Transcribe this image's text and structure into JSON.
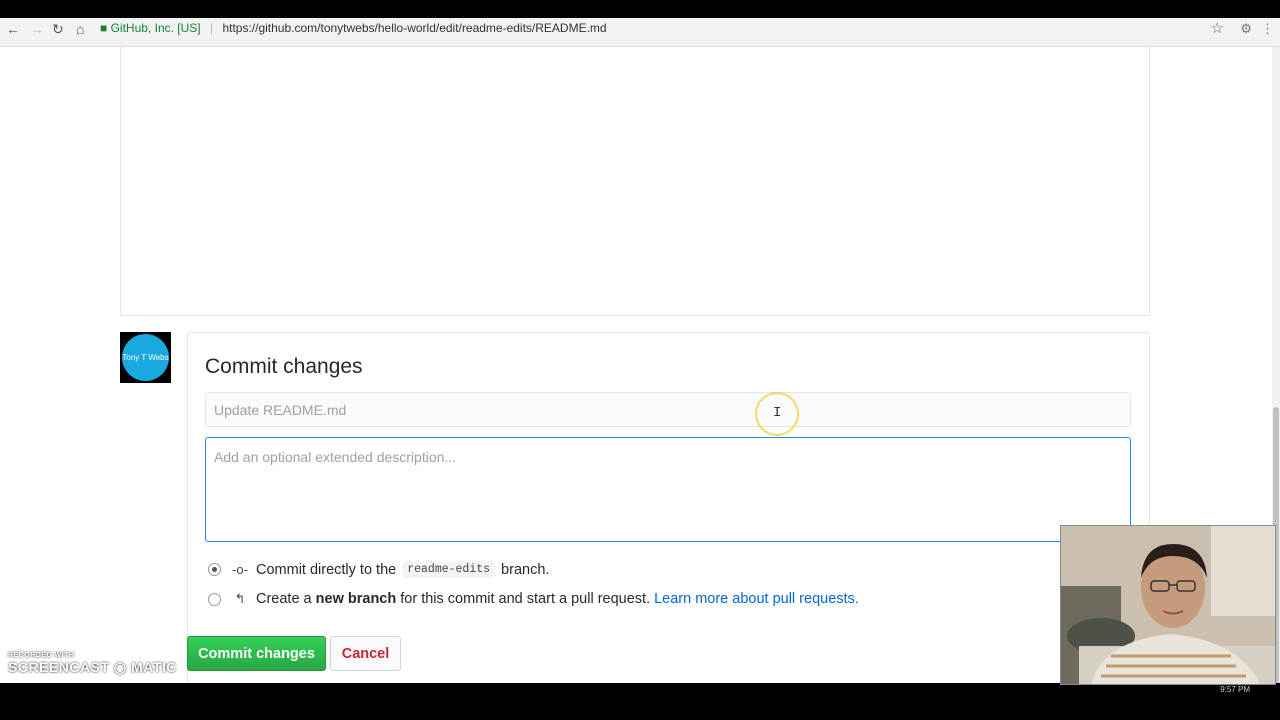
{
  "browser": {
    "security_label": "GitHub, Inc. [US]",
    "url": "https://github.com/tonytwebs/hello-world/edit/readme-edits/README.md"
  },
  "avatar": {
    "text": "Tony T Webs"
  },
  "commit": {
    "title": "Commit changes",
    "summary_placeholder": "Update README.md",
    "description_placeholder": "Add an optional extended description...",
    "option_direct": {
      "prefix": "Commit directly to the",
      "branch": "readme-edits",
      "suffix": "branch."
    },
    "option_new_branch": {
      "prefix": "Create a",
      "bold": "new branch",
      "suffix": "for this commit and start a pull request.",
      "link": "Learn more about pull requests."
    },
    "commit_button": "Commit changes",
    "cancel_button": "Cancel"
  },
  "watermark": {
    "line1": "RECORDED WITH",
    "line2": "SCREENCAST",
    "line3": "MATIC"
  },
  "taskbar": {
    "clock": "9:57 PM"
  },
  "colors": {
    "accent_green": "#28a745",
    "link_blue": "#0366d6",
    "cancel_red": "#cb2431",
    "avatar_blue": "#19a9e0"
  }
}
